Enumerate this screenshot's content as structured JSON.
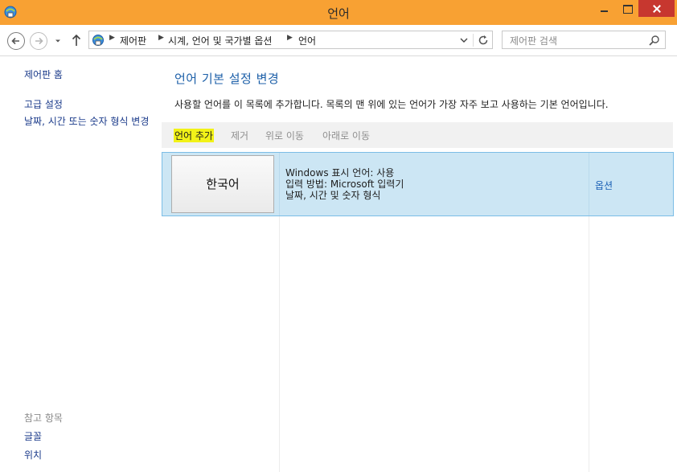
{
  "window": {
    "title": "언어"
  },
  "address_bar": {
    "breadcrumbs": [
      "제어판",
      "시계, 언어 및 국가별 옵션",
      "언어"
    ]
  },
  "search": {
    "placeholder": "제어판 검색"
  },
  "sidebar": {
    "home": "제어판 홈",
    "advanced_settings": "고급 설정",
    "date_time_format": "날짜, 시간 또는 숫자 형식 변경",
    "see_also_heading": "참고 항목",
    "see_also": [
      "글꼴",
      "위치"
    ]
  },
  "main": {
    "title": "언어 기본 설정 변경",
    "description": "사용할 언어를 이 목록에 추가합니다. 목록의 맨 위에 있는 언어가 가장 자주 보고 사용하는 기본 언어입니다."
  },
  "toolbar": {
    "add_language": "언어 추가",
    "remove": "제거",
    "move_up": "위로 이동",
    "move_down": "아래로 이동"
  },
  "languages": [
    {
      "name": "한국어",
      "details": [
        "Windows 표시 언어: 사용",
        "입력 방법: Microsoft 입력기",
        "날짜, 시간 및 숫자 형식"
      ],
      "options_link": "옵션"
    }
  ],
  "colors": {
    "titlebar": "#f8a133",
    "close_button": "#c7372f",
    "selected_row": "#cce6f4",
    "highlight": "#f2f218",
    "link": "#1a3a8a",
    "title_text": "#1c5fa8"
  },
  "icons": [
    "control-panel-icon",
    "back-arrow-icon",
    "forward-arrow-icon",
    "chevron-down-icon",
    "up-arrow-icon",
    "refresh-icon",
    "search-icon"
  ]
}
